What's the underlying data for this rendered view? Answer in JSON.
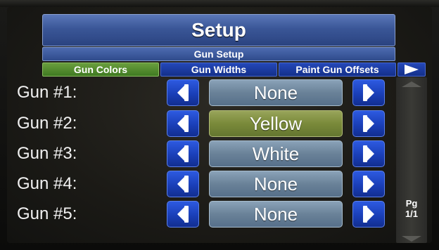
{
  "header": {
    "title": "Setup",
    "subtitle": "Gun Setup"
  },
  "tabs": [
    {
      "label": "Gun Colors",
      "active": true
    },
    {
      "label": "Gun Widths",
      "active": false
    },
    {
      "label": "Paint Gun Offsets",
      "active": false
    }
  ],
  "tab_next_icon": "right-triangle-icon",
  "guns": [
    {
      "label": "Gun #1:",
      "value": "None",
      "selected": false
    },
    {
      "label": "Gun #2:",
      "value": "Yellow",
      "selected": true
    },
    {
      "label": "Gun #3:",
      "value": "White",
      "selected": false
    },
    {
      "label": "Gun #4:",
      "value": "None",
      "selected": false
    },
    {
      "label": "Gun #5:",
      "value": "None",
      "selected": false
    }
  ],
  "pager": {
    "line1": "Pg",
    "line2": "1/1"
  },
  "colors": {
    "active_tab": "#4f8a2e",
    "inactive_tab": "#1c3ea6",
    "selected_value": "#7a8a3a",
    "normal_value": "#6a8298",
    "arrow_button": "#1f48c8"
  }
}
